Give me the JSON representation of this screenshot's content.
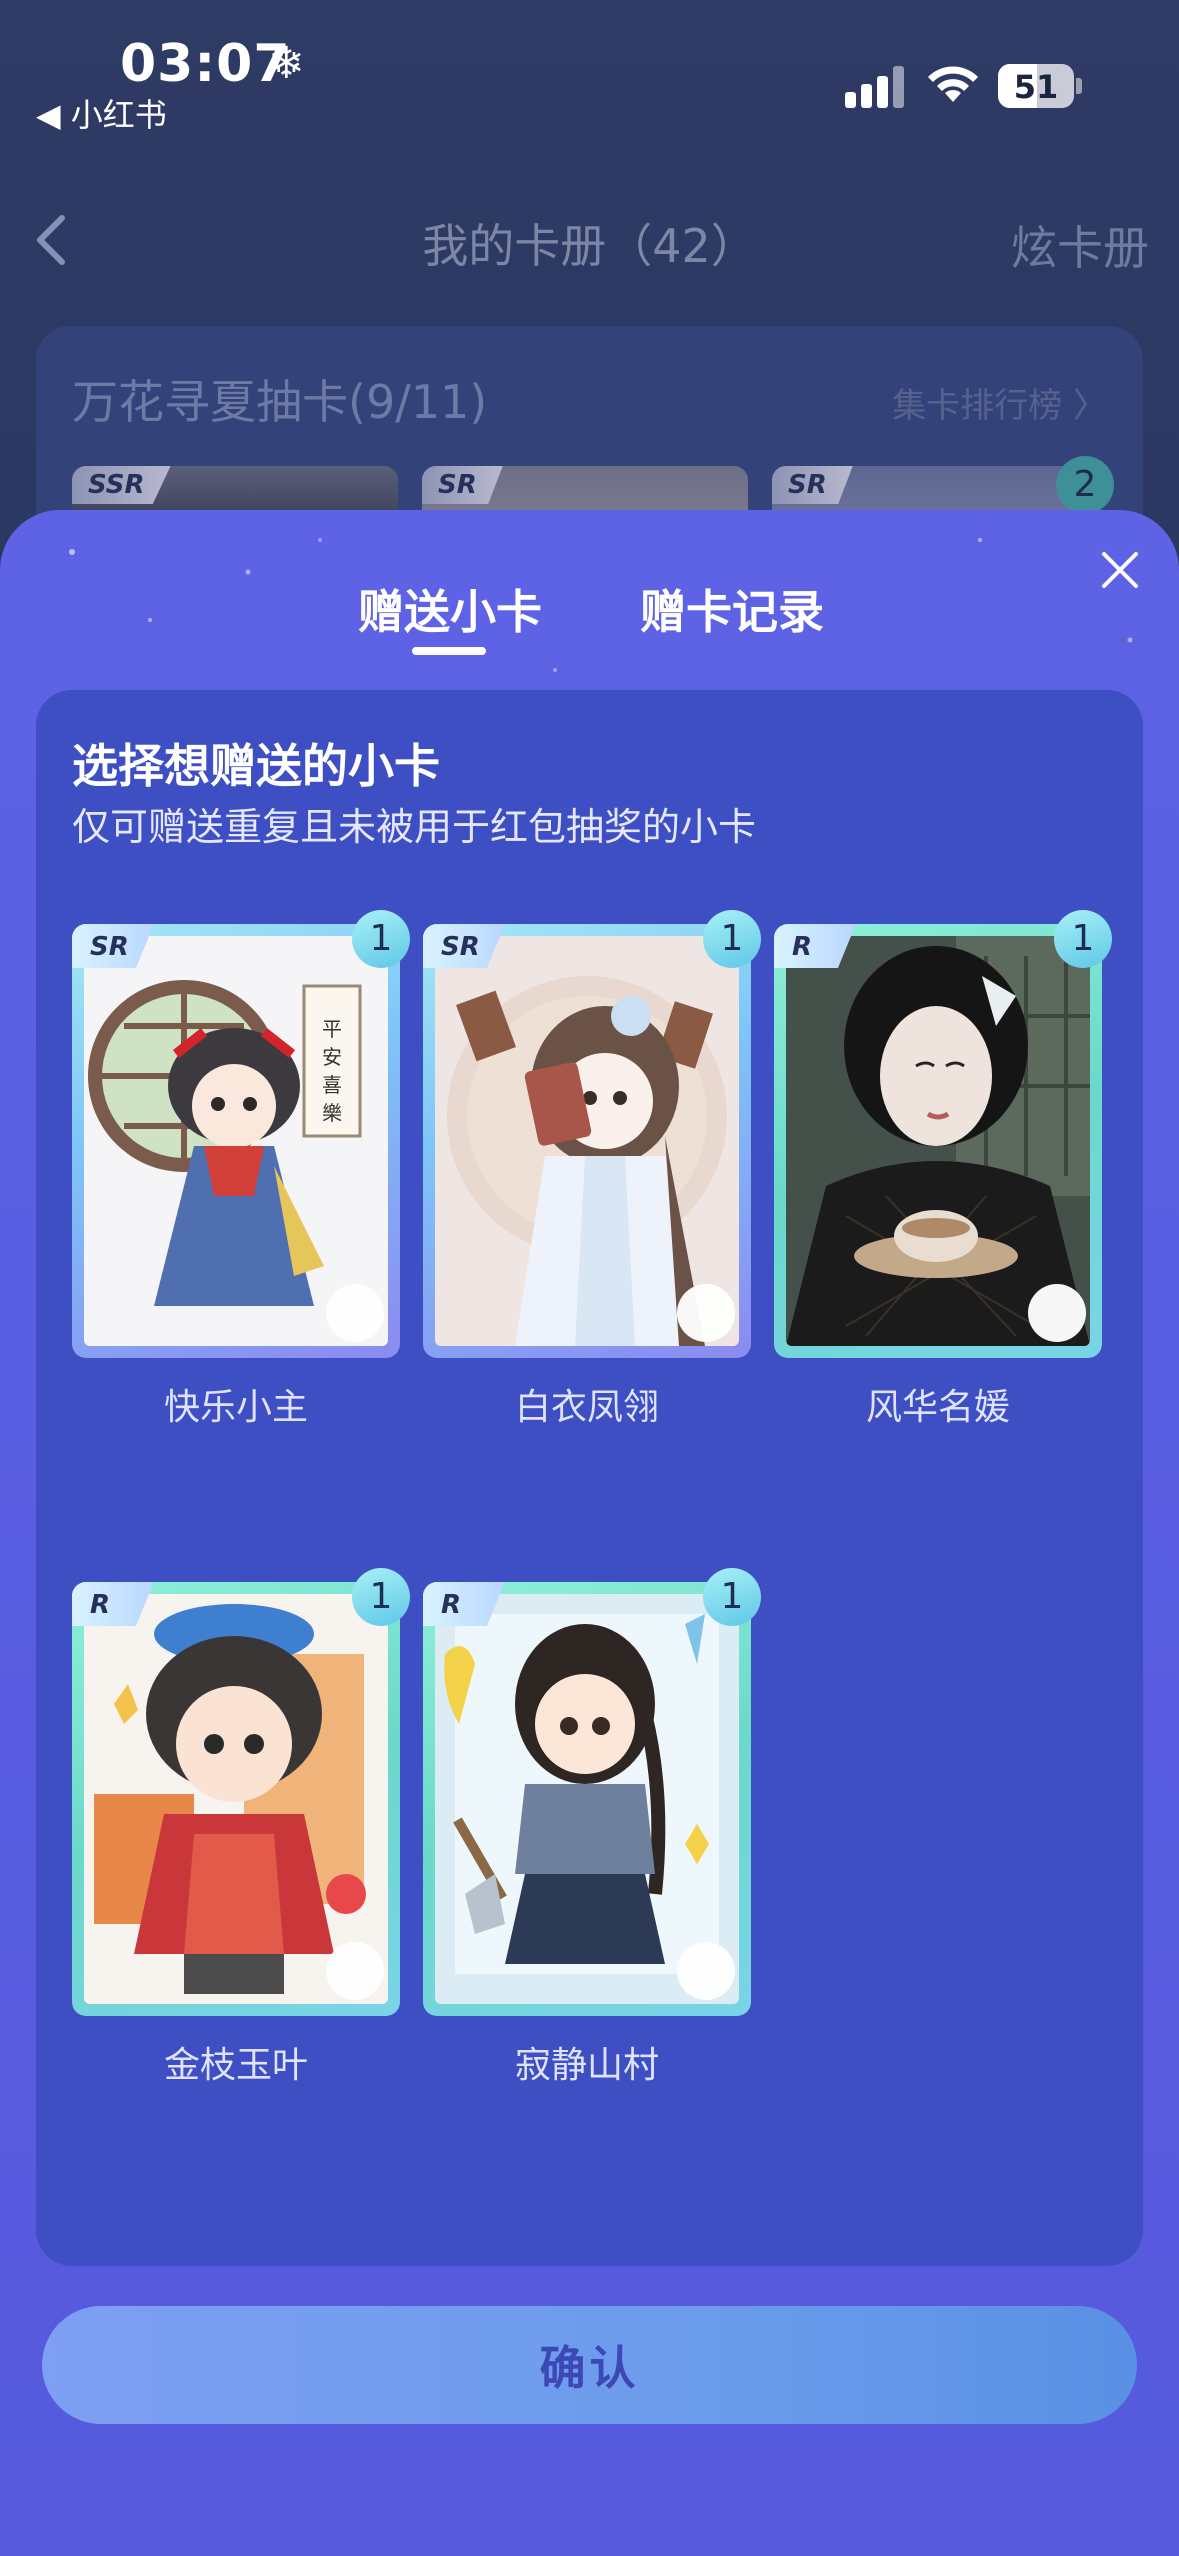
{
  "status_bar": {
    "time": "03:07",
    "back_app": "◀ 小红书",
    "battery": "51"
  },
  "nav": {
    "title": "我的卡册（42）",
    "right_action": "炫卡册"
  },
  "collection": {
    "title": "万花寻夏抽卡(9/11)",
    "rank_link": "集卡排行榜 〉",
    "mini_cards": [
      {
        "rarity": "SSR"
      },
      {
        "rarity": "SR"
      },
      {
        "rarity": "SR",
        "count": "2"
      }
    ]
  },
  "sheet": {
    "tabs": [
      {
        "label": "赠送小卡",
        "active": true
      },
      {
        "label": "赠卡记录",
        "active": false
      }
    ],
    "panel_title": "选择想赠送的小卡",
    "panel_subtitle": "仅可赠送重复且未被用于红包抽奖的小卡",
    "cards": [
      {
        "name": "快乐小主",
        "rarity": "SR",
        "count": "1"
      },
      {
        "name": "白衣凤翎",
        "rarity": "SR",
        "count": "1"
      },
      {
        "name": "风华名媛",
        "rarity": "R",
        "count": "1"
      },
      {
        "name": "金枝玉叶",
        "rarity": "R",
        "count": "1"
      },
      {
        "name": "寂静山村",
        "rarity": "R",
        "count": "1"
      }
    ],
    "confirm_label": "确认"
  },
  "colors": {
    "sheet_bg": "#5e62e4",
    "panel_bg": "#3d4fc3",
    "confirm_bg": "#6b9ceb"
  }
}
